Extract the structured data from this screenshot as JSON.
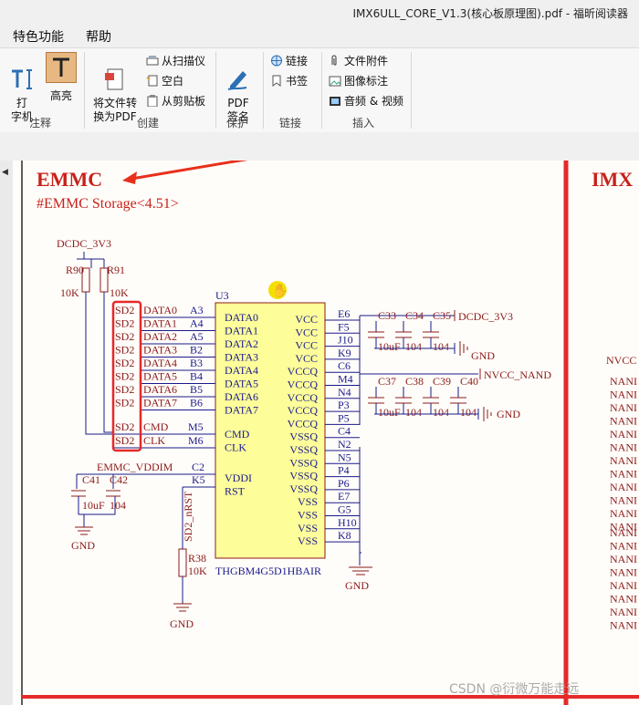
{
  "window": {
    "title": "IMX6ULL_CORE_V1.3(核心板原理图).pdf - 福昕阅读器"
  },
  "menu": {
    "items": [
      "特色功能",
      "帮助"
    ]
  },
  "ribbon": {
    "typewriter": "打\n字机",
    "highlight": "高亮",
    "annotate_group": "注释",
    "convert": "将文件转\n换为PDF",
    "from_scanner": "从扫描仪",
    "blank": "空白",
    "from_clipboard": "从剪贴板",
    "create_group": "创建",
    "pdf_sign": "PDF\n签名",
    "protect_group": "保护",
    "link": "链接",
    "bookmark": "书签",
    "link_group": "链接",
    "file_attachment": "文件附件",
    "image_annotation": "图像标注",
    "audio_video": "音频 & 视频",
    "insert_group": "插入"
  },
  "schematic": {
    "heading": "EMMC",
    "heading_right": "IMX",
    "subtitle": "#EMMC Storage<4.51>",
    "power_3v3": "DCDC_3V3",
    "r90": "R90",
    "r91": "R91",
    "r90_val": "10K",
    "r91_val": "10K",
    "chip_ref": "U3",
    "chip_part": "THGBM4G5D1HBAIR",
    "left_nets": [
      "SD2",
      "SD2",
      "SD2",
      "SD2",
      "SD2",
      "SD2",
      "SD2",
      "SD2"
    ],
    "left_signals": [
      "DATA0",
      "DATA1",
      "DATA2",
      "DATA3",
      "DATA4",
      "DATA5",
      "DATA6",
      "DATA7"
    ],
    "left_balls": [
      "A3",
      "A4",
      "A5",
      "B2",
      "B3",
      "B4",
      "B5",
      "B6"
    ],
    "chip_left_pins": [
      "DATA0",
      "DATA1",
      "DATA2",
      "DATA3",
      "DATA4",
      "DATA5",
      "DATA6",
      "DATA7",
      "CMD",
      "CLK",
      "VDDI",
      "RST"
    ],
    "cmd_net": "SD2",
    "cmd_sig": "CMD",
    "cmd_ball": "M5",
    "clk_net": "SD2",
    "clk_sig": "CLK",
    "clk_ball": "M6",
    "vddim_net": "EMMC_VDDIM",
    "vddim_ball": "C2",
    "rst_ball": "K5",
    "chip_right_pins": [
      "VCC",
      "VCC",
      "VCC",
      "VCC",
      "VCCQ",
      "VCCQ",
      "VCCQ",
      "VCCQ",
      "VCCQ",
      "VSSQ",
      "VSSQ",
      "VSSQ",
      "VSSQ",
      "VSSQ",
      "VSS",
      "VSS",
      "VSS",
      "VSS"
    ],
    "right_balls": [
      "E6",
      "F5",
      "J10",
      "K9",
      "C6",
      "M4",
      "N4",
      "P3",
      "P5",
      "C4",
      "N2",
      "N5",
      "P4",
      "P6",
      "E7",
      "G5",
      "H10",
      "K8"
    ],
    "caps_top": [
      "C33",
      "C34",
      "C35"
    ],
    "caps_top_vals": [
      "10uF",
      "104",
      "104"
    ],
    "caps_mid": [
      "C37",
      "C38",
      "C39",
      "C40"
    ],
    "caps_mid_vals": [
      "10uF",
      "104",
      "104",
      "104"
    ],
    "net_3v3_right": "DCDC_3V3",
    "net_nand": "NVCC_NAND",
    "gnd": "GND",
    "caps_left": [
      "C41",
      "C42"
    ],
    "caps_left_vals": [
      "10uF",
      "104"
    ],
    "nrst_net": "SD2_nRST",
    "r38": "R38",
    "r38_val": "10K",
    "right_col_top": "NVCC",
    "right_col_label": "NANI"
  },
  "watermark": "CSDN @衍微万能走远",
  "colors": {
    "wire": "#1a1a8c",
    "component": "#8b1a1a",
    "chip_fill": "#fdfd9a",
    "annotation": "#e8301c"
  }
}
